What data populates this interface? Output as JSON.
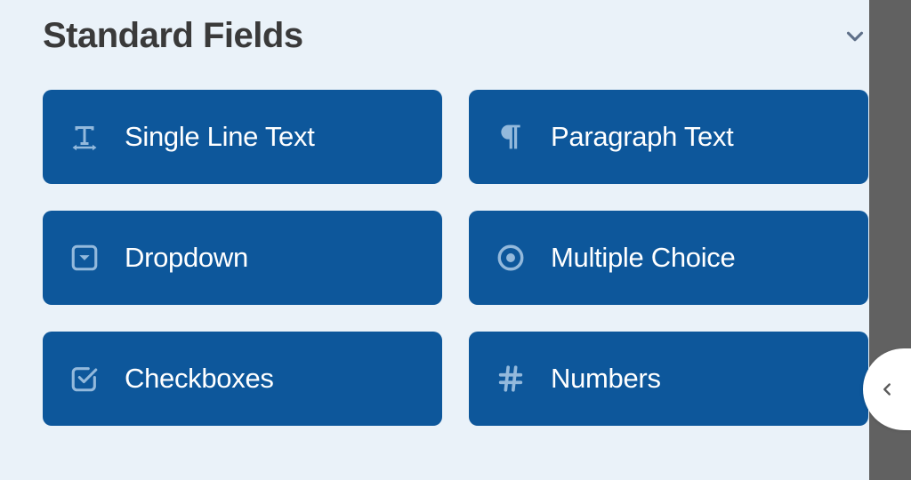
{
  "section": {
    "title": "Standard Fields"
  },
  "fields": {
    "single_line_text": {
      "label": "Single Line Text"
    },
    "paragraph_text": {
      "label": "Paragraph Text"
    },
    "dropdown": {
      "label": "Dropdown"
    },
    "multiple_choice": {
      "label": "Multiple Choice"
    },
    "checkboxes": {
      "label": "Checkboxes"
    },
    "numbers": {
      "label": "Numbers"
    }
  },
  "colors": {
    "page_bg": "#eaf2f9",
    "button_bg": "#0d579b",
    "button_text": "#ffffff",
    "icon": "#93b9dc",
    "title": "#3a3a3a",
    "rail": "#616161"
  }
}
